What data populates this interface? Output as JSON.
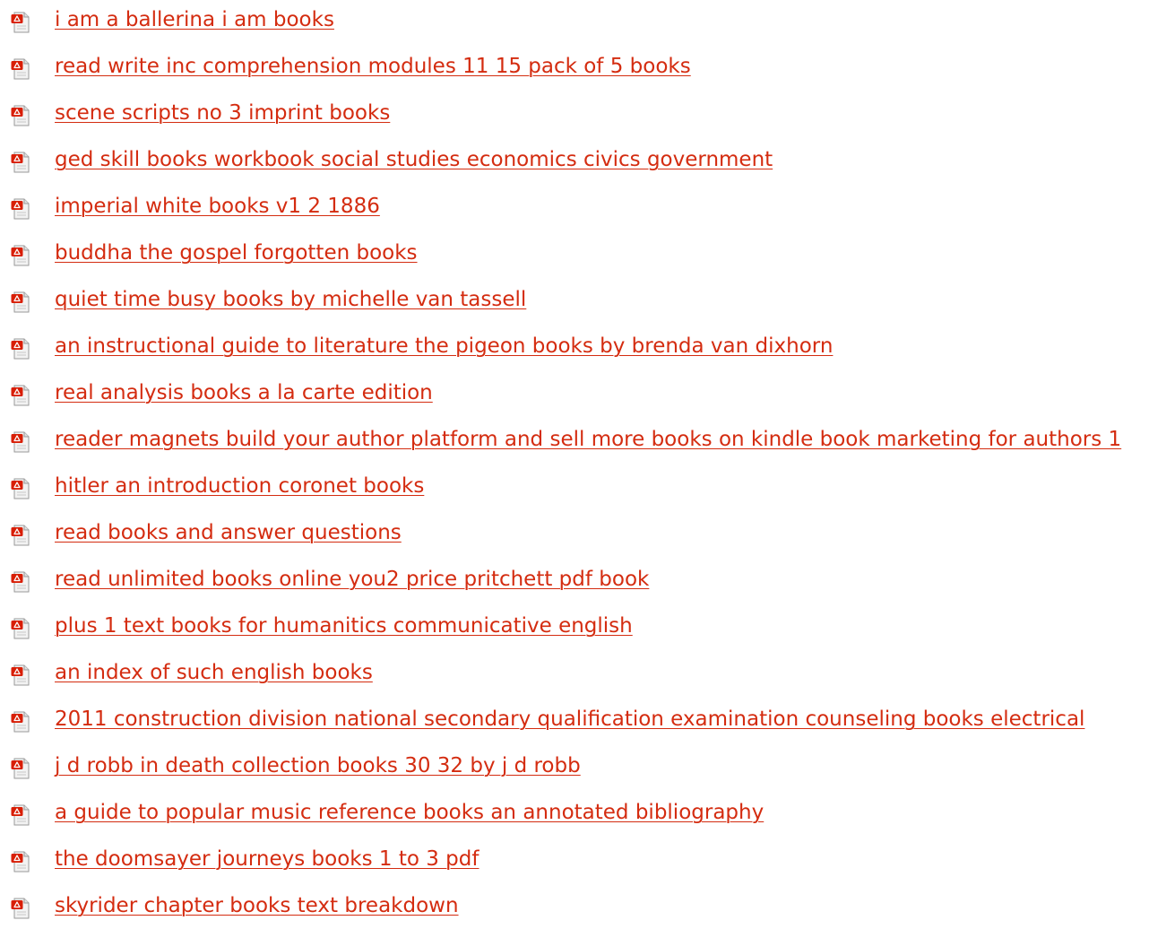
{
  "icon": "pdf-file-icon",
  "colors": {
    "link": "#d42c10",
    "icon_red": "#d81e05",
    "icon_paper": "#f2f2f2",
    "background": "#ffffff"
  },
  "links": [
    {
      "label": "i am a ballerina i am books"
    },
    {
      "label": "read write inc comprehension modules 11 15 pack of 5 books"
    },
    {
      "label": "scene scripts no 3 imprint books"
    },
    {
      "label": "ged skill books workbook social studies economics civics government"
    },
    {
      "label": "imperial white books v1 2 1886"
    },
    {
      "label": "buddha the gospel forgotten books"
    },
    {
      "label": "quiet time busy books by michelle van tassell"
    },
    {
      "label": "an instructional guide to literature the pigeon books by brenda van dixhorn"
    },
    {
      "label": "real analysis books a la carte edition"
    },
    {
      "label": "reader magnets build your author platform and sell more books on kindle book marketing for authors 1"
    },
    {
      "label": "hitler an introduction coronet books"
    },
    {
      "label": "read books and answer questions"
    },
    {
      "label": "read unlimited books online you2 price pritchett pdf book"
    },
    {
      "label": "plus 1 text books for humanitics communicative english"
    },
    {
      "label": "an index of such english books"
    },
    {
      "label": "2011 construction division national secondary qualification examination counseling books electrical"
    },
    {
      "label": "j d robb in death collection books 30 32 by j d robb"
    },
    {
      "label": "a guide to popular music reference books an annotated bibliography"
    },
    {
      "label": "the doomsayer journeys books 1 to 3 pdf"
    },
    {
      "label": "skyrider chapter books text breakdown"
    }
  ]
}
